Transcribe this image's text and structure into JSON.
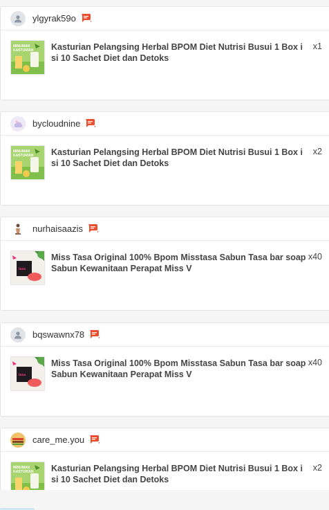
{
  "orders": [
    {
      "username": "ylgyrak59o",
      "avatar": "default",
      "product": "Kasturian Pelangsing Herbal BPOM Diet Nutrisi Busui 1 Box isi 10 Sachet Diet dan Detoks",
      "qty": "x1",
      "thumb": "kasturian"
    },
    {
      "username": "bycloudnine",
      "avatar": "cloud",
      "product": "Kasturian Pelangsing Herbal BPOM Diet Nutrisi Busui 1 Box isi 10 Sachet Diet dan Detoks",
      "qty": "x2",
      "thumb": "kasturian"
    },
    {
      "username": "nurhaisaazis",
      "avatar": "figure",
      "product": "Miss Tasa Original 100% Bpom Misstasa Sabun Tasa bar soap Sabun Kewanitaan Perapat Miss V",
      "qty": "x40",
      "thumb": "misstasa"
    },
    {
      "username": "bqswawnx78",
      "avatar": "default",
      "product": "Miss Tasa Original 100% Bpom Misstasa Sabun Tasa bar soap Sabun Kewanitaan Perapat Miss V",
      "qty": "x40",
      "thumb": "misstasa"
    },
    {
      "username": "care_me.you",
      "avatar": "food",
      "product": "Kasturian Pelangsing Herbal BPOM Diet Nutrisi Busui 1 Box isi 10 Sachet Diet dan Detoks",
      "qty": "x2",
      "thumb": "kasturian"
    }
  ],
  "icons": {
    "chat": "chat-icon"
  },
  "colors": {
    "chat": "#ee4d2d",
    "kasturian_bg": "#9fd26a",
    "misstasa_accent": "#e8337a"
  }
}
